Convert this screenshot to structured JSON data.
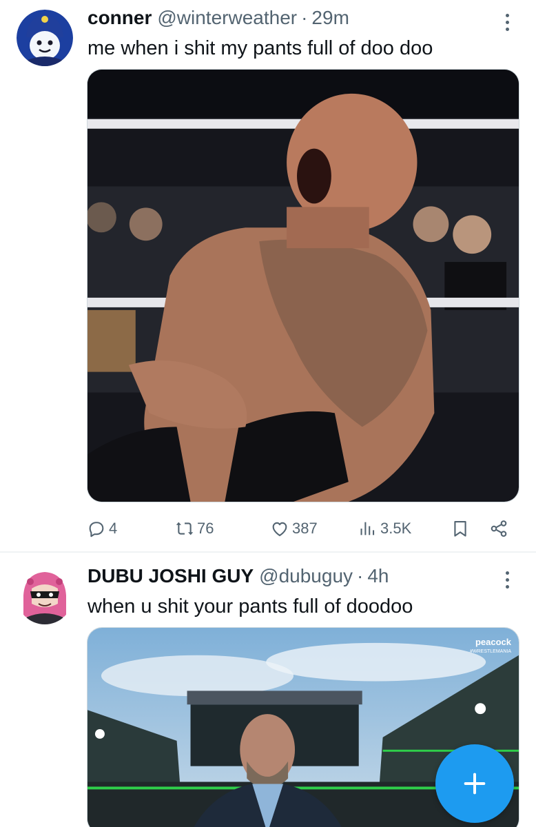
{
  "tweets": [
    {
      "display_name": "conner",
      "handle": "@winterweather",
      "separator": "·",
      "time": "29m",
      "text": "me when i shit my pants full of doo doo",
      "stats": {
        "replies": "4",
        "reposts": "76",
        "likes": "387",
        "views": "3.5K"
      }
    },
    {
      "display_name": "DUBU JOSHI GUY",
      "handle": "@dubuguy",
      "separator": "·",
      "time": "4h",
      "text": "when u shit your pants full of doodoo",
      "media_watermark": "peacock",
      "media_watermark_sub": "#WRESTLEMANIA"
    }
  ],
  "icons": {
    "reply": "reply-icon",
    "repost": "repost-icon",
    "like": "heart-icon",
    "views": "views-icon",
    "bookmark": "bookmark-icon",
    "share": "share-icon",
    "compose": "plus-icon",
    "more": "more-options-icon"
  },
  "colors": {
    "accent": "#1d9bf0",
    "secondary_text": "#536471",
    "primary_text": "#0f1419",
    "divider": "#eff3f4"
  }
}
